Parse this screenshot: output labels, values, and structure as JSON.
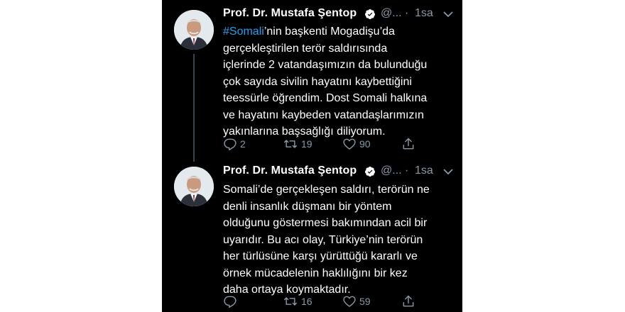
{
  "tweets": [
    {
      "author_name": "Prof. Dr. Mustafa Şentop",
      "handle": "@...",
      "separator": "·",
      "time": "1sa",
      "text_lines": [
        {
          "hashtag": "#Somali",
          "rest": "’nin başkenti Mogadişu’da"
        },
        "gerçekleştirilen terör saldırısında",
        "içlerinde 2 vatandaşımızın da bulunduğu",
        "çok sayıda sivilin hayatını kaybettiğini",
        "teessürle öğrendim. Dost Somali halkına",
        "ve hayatını kaybeden vatandaşlarımızın",
        "yakınlarına başsağlığı diliyorum."
      ],
      "replies": "2",
      "retweets": "19",
      "likes": "90"
    },
    {
      "author_name": "Prof. Dr. Mustafa Şentop",
      "handle": "@...",
      "separator": "·",
      "time": "1sa",
      "text_lines": [
        "Somali’de gerçekleşen saldırı, terörün ne",
        "denli insanlık düşmanı bir yöntem",
        "olduğunu göstermesi bakımından acil bir",
        "uyarıdır. Bu acı olay, Türkiye’nin terörün",
        "her türlüsüne karşı yürüttüğü kararlı ve",
        "örnek mücadelenin haklılığını bir kez",
        "daha ortaya koymaktadır."
      ],
      "replies": "",
      "retweets": "16",
      "likes": "59"
    }
  ],
  "icons": {
    "verified": "verified-badge-icon",
    "caret": "chevron-down-icon",
    "reply": "reply-icon",
    "retweet": "retweet-icon",
    "like": "heart-icon",
    "share": "share-icon"
  },
  "colors": {
    "background": "#000000",
    "text": "#ffffff",
    "secondary": "#8899a6",
    "hashtag": "#1da1f2",
    "thread_line": "#38444d"
  }
}
